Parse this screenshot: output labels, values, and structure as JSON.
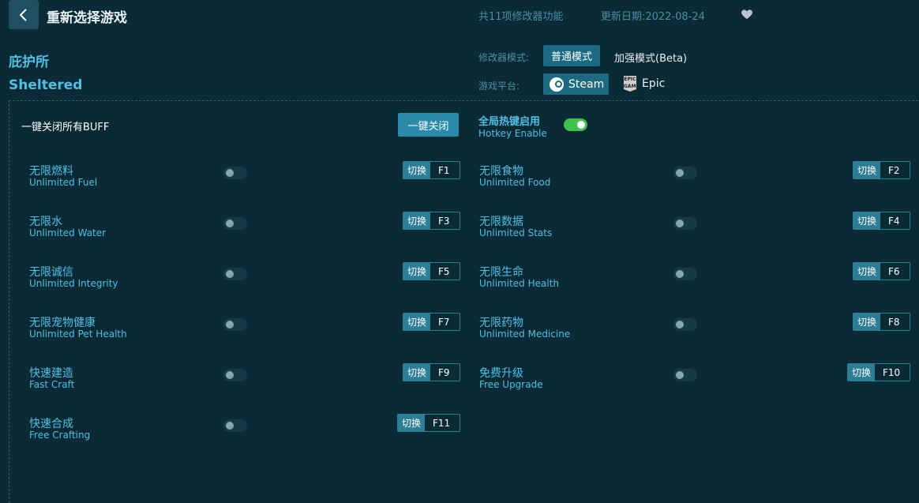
{
  "header": {
    "back_label": "<",
    "title": "重新选择游戏",
    "feature_count": "共11项修改器功能",
    "update_date": "更新日期:2022-08-24"
  },
  "game": {
    "name_cn": "庇护所",
    "name_en": "Sheltered"
  },
  "mode": {
    "label": "修改器模式:",
    "normal": "普通模式",
    "beta": "加强模式(Beta)",
    "selected": "普通模式"
  },
  "platform": {
    "label": "游戏平台:",
    "steam": "Steam",
    "epic": "Epic",
    "epic_icon_text": "EPIC GAMES",
    "selected": "Steam"
  },
  "controls": {
    "buff_label": "一键关闭所有BUFF",
    "buff_button": "一键关闭",
    "hotkey_cn": "全局热键启用",
    "hotkey_en": "Hotkey Enable",
    "hotkey_enabled": true
  },
  "switch_label": "切换",
  "features": [
    {
      "cn": "无限燃料",
      "en": "Unlimited Fuel",
      "key": "F1",
      "enabled": false
    },
    {
      "cn": "无限食物",
      "en": "Unlimited Food",
      "key": "F2",
      "enabled": false
    },
    {
      "cn": "无限水",
      "en": "Unlimited Water",
      "key": "F3",
      "enabled": false
    },
    {
      "cn": "无限数据",
      "en": "Unlimited Stats",
      "key": "F4",
      "enabled": false
    },
    {
      "cn": "无限诚信",
      "en": "Unlimited Integrity",
      "key": "F5",
      "enabled": false
    },
    {
      "cn": "无限生命",
      "en": "Unlimited Health",
      "key": "F6",
      "enabled": false
    },
    {
      "cn": "无限宠物健康",
      "en": "Unlimited Pet Health",
      "key": "F7",
      "enabled": false
    },
    {
      "cn": "无限药物",
      "en": "Unlimited Medicine",
      "key": "F8",
      "enabled": false
    },
    {
      "cn": "快速建造",
      "en": "Fast Craft",
      "key": "F9",
      "enabled": false
    },
    {
      "cn": "免费升级",
      "en": "Free Upgrade",
      "key": "F10",
      "enabled": false
    },
    {
      "cn": "快速合成",
      "en": "Free Crafting",
      "key": "F11",
      "enabled": false
    }
  ],
  "colors": {
    "background": "#0a2a35",
    "accent": "#4fc0e6",
    "button": "#1b6a82",
    "toggle_on": "#3fc24b"
  },
  "icons": {
    "back": "chevron-left-icon",
    "favorite": "heart-icon",
    "steam": "steam-icon",
    "epic": "epic-games-icon"
  }
}
